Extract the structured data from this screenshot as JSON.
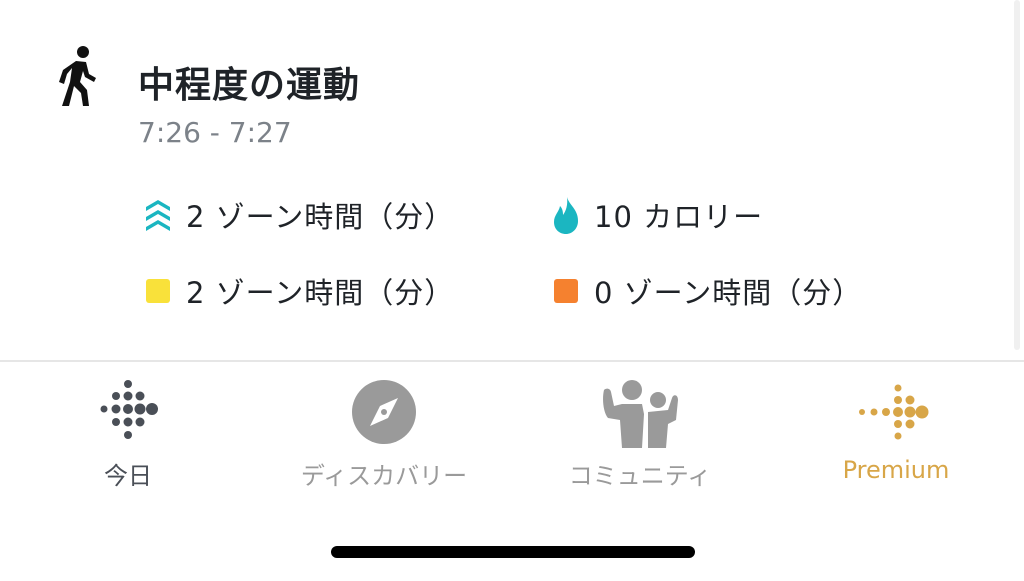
{
  "activity": {
    "title": "中程度の運動",
    "time_range": "7:26 - 7:27",
    "stats": [
      {
        "icon": "zone-chevrons-icon",
        "label": "2 ゾーン時間（分）",
        "color": "#1bb6c1"
      },
      {
        "icon": "flame-icon",
        "label": "10 カロリー",
        "color": "#1bb6c1"
      },
      {
        "icon": "yellow-zone-icon",
        "label": "2 ゾーン時間（分）",
        "color": "#f9e13a"
      },
      {
        "icon": "orange-zone-icon",
        "label": "0 ゾーン時間（分）",
        "color": "#f5812f"
      }
    ]
  },
  "tabbar": {
    "tabs": [
      {
        "id": "today",
        "label": "今日",
        "icon": "fitbit-dots-icon",
        "color": "#4a4f57",
        "active": true
      },
      {
        "id": "discover",
        "label": "ディスカバリー",
        "icon": "compass-icon",
        "color": "#9a9a9a",
        "active": false
      },
      {
        "id": "community",
        "label": "コミュニティ",
        "icon": "community-people-icon",
        "color": "#9a9a9a",
        "active": false
      },
      {
        "id": "premium",
        "label": "Premium",
        "icon": "premium-dots-icon",
        "color": "#d8a648",
        "active": false
      }
    ]
  },
  "colors": {
    "text_primary": "#1f2328",
    "text_secondary": "#7c8289",
    "teal": "#1bb6c1",
    "yellow": "#f9e13a",
    "orange": "#f5812f",
    "premium_gold": "#d8a648",
    "inactive_gray": "#9a9a9a"
  }
}
